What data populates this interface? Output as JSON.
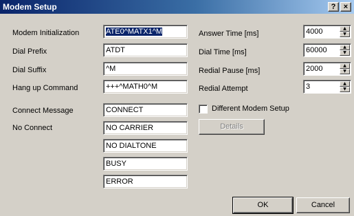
{
  "window": {
    "title": "Modem Setup",
    "help_label": "?",
    "close_label": "×"
  },
  "left": {
    "modem_init_label": "Modem Initialization",
    "modem_init_value": "ATE0^MATX1^M",
    "dial_prefix_label": "Dial Prefix",
    "dial_prefix_value": "ATDT",
    "dial_suffix_label": "Dial Suffix",
    "dial_suffix_value": "^M",
    "hangup_label": "Hang up Command",
    "hangup_value": "+++^MATH0^M",
    "connect_message_label": "Connect Message",
    "connect_message_value": "CONNECT",
    "no_connect_label": "No Connect",
    "no_connect_values": [
      "NO CARRIER",
      "NO DIALTONE",
      "BUSY",
      "ERROR"
    ]
  },
  "right": {
    "answer_time_label": "Answer Time [ms]",
    "answer_time_value": "4000",
    "dial_time_label": "Dial Time [ms]",
    "dial_time_value": "60000",
    "redial_pause_label": "Redial Pause [ms]",
    "redial_pause_value": "2000",
    "redial_attempt_label": "Redial Attempt",
    "redial_attempt_value": "3",
    "different_setup_label": "Different Modem Setup",
    "different_setup_checked": false,
    "details_label": "Details"
  },
  "buttons": {
    "ok": "OK",
    "cancel": "Cancel"
  }
}
